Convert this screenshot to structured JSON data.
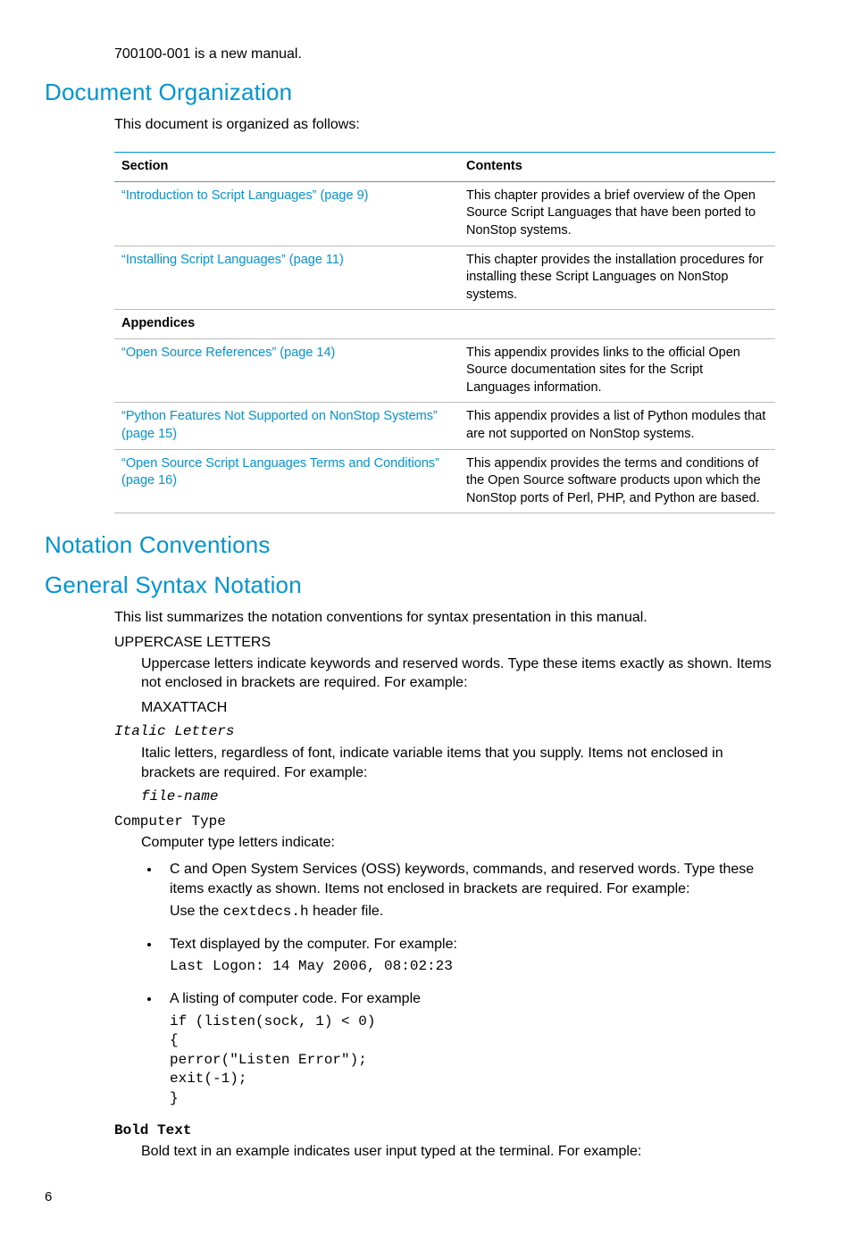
{
  "intro": "700100-001 is a new manual.",
  "headings": {
    "docorg": "Document Organization",
    "notation": "Notation Conventions",
    "syntax": "General Syntax Notation"
  },
  "docorg_intro": "This document is organized as follows:",
  "table": {
    "col1": "Section",
    "col2": "Contents",
    "rows_top": [
      {
        "section": "“Introduction to Script Languages” (page 9)",
        "contents": "This chapter provides a brief overview of the Open Source Script Languages that have been ported to NonStop systems."
      },
      {
        "section": "“Installing Script Languages” (page 11)",
        "contents": "This chapter provides the installation procedures for installing these Script Languages on NonStop systems."
      }
    ],
    "appendices_label": "Appendices",
    "rows_app": [
      {
        "section": "“Open Source References” (page 14)",
        "contents": "This appendix provides links to the official Open Source documentation sites for the Script Languages information."
      },
      {
        "section": "“Python Features Not Supported on NonStop Systems” (page 15)",
        "contents": "This appendix provides a list of Python modules that are not supported on NonStop systems."
      },
      {
        "section": "“Open Source Script Languages Terms and Conditions” (page 16)",
        "contents": "This appendix provides the terms and conditions of the Open Source software products upon which the NonStop ports of Perl, PHP, and Python are based."
      }
    ]
  },
  "syntax_intro": "This list summarizes the notation conventions for syntax presentation in this manual.",
  "upper": {
    "term": "UPPERCASE LETTERS",
    "def": "Uppercase letters indicate keywords and reserved words. Type these items exactly as shown. Items not enclosed in brackets are required. For example:",
    "example": "MAXATTACH"
  },
  "italic": {
    "term": "Italic Letters",
    "def": "Italic letters, regardless of font, indicate variable items that you supply. Items not enclosed in brackets are required. For example:",
    "example": "file-name"
  },
  "comp": {
    "term": "Computer Type",
    "def": "Computer type letters indicate:",
    "b1a": "C and Open System Services (OSS) keywords, commands, and reserved words. Type these items exactly as shown. Items not enclosed in brackets are required. For example:",
    "b1b_pre": "Use the ",
    "b1b_code": "cextdecs.h",
    "b1b_post": " header file.",
    "b2a": "Text displayed by the computer. For example:",
    "b2b": "Last Logon: 14 May 2006, 08:02:23",
    "b3a": "A listing of computer code. For example",
    "b3b": "if (listen(sock, 1) < 0)\n{\nperror(\"Listen Error\");\nexit(-1);\n}"
  },
  "bold": {
    "term": "Bold Text",
    "def": "Bold text in an example indicates user input typed at the terminal. For example:"
  },
  "page_number": "6"
}
